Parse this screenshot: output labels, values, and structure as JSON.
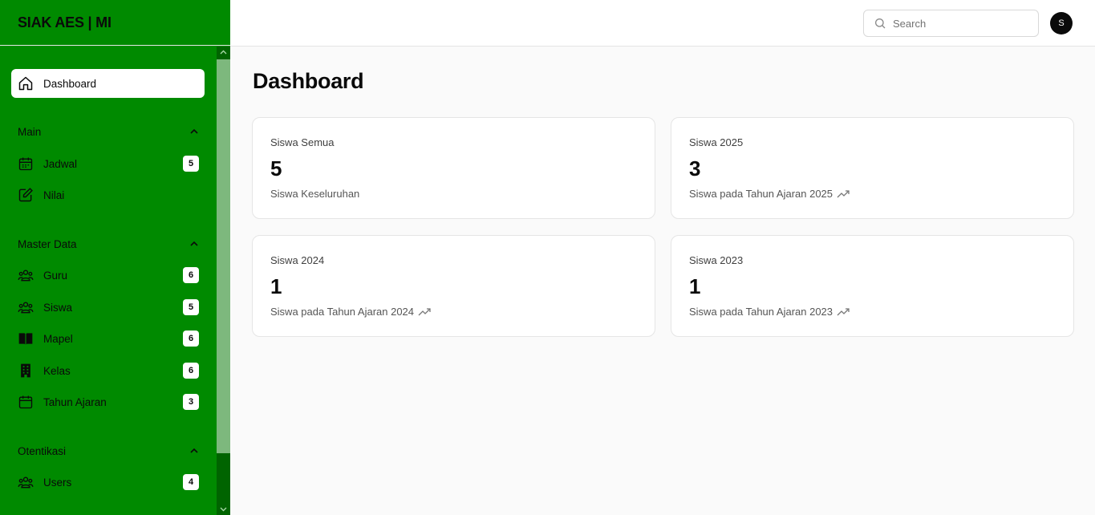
{
  "app": {
    "brand": "SIAK AES | MI"
  },
  "sidebar": {
    "active_item": {
      "label": "Dashboard",
      "icon": "home-icon"
    },
    "groups": [
      {
        "label": "Main",
        "items": [
          {
            "label": "Jadwal",
            "icon": "calendar-grid-icon",
            "badge": "5"
          },
          {
            "label": "Nilai",
            "icon": "edit-icon",
            "badge": ""
          }
        ]
      },
      {
        "label": "Master Data",
        "items": [
          {
            "label": "Guru",
            "icon": "users-icon",
            "badge": "6"
          },
          {
            "label": "Siswa",
            "icon": "users-icon",
            "badge": "5"
          },
          {
            "label": "Mapel",
            "icon": "book-icon",
            "badge": "6"
          },
          {
            "label": "Kelas",
            "icon": "building-icon",
            "badge": "6"
          },
          {
            "label": "Tahun Ajaran",
            "icon": "calendar-icon",
            "badge": "3"
          }
        ]
      },
      {
        "label": "Otentikasi",
        "items": [
          {
            "label": "Users",
            "icon": "users-icon",
            "badge": "4"
          }
        ]
      }
    ]
  },
  "header": {
    "search_placeholder": "Search",
    "avatar_initial": "S"
  },
  "main": {
    "title": "Dashboard",
    "cards": [
      {
        "title": "Siswa Semua",
        "value": "5",
        "subtitle": "Siswa Keseluruhan",
        "trend_icon": false
      },
      {
        "title": "Siswa 2025",
        "value": "3",
        "subtitle": "Siswa pada Tahun Ajaran 2025",
        "trend_icon": true
      },
      {
        "title": "Siswa 2024",
        "value": "1",
        "subtitle": "Siswa pada Tahun Ajaran 2024",
        "trend_icon": true
      },
      {
        "title": "Siswa 2023",
        "value": "1",
        "subtitle": "Siswa pada Tahun Ajaran 2023",
        "trend_icon": true
      }
    ]
  },
  "colors": {
    "sidebar_bg": "#008a00",
    "scroll_track": "#006400",
    "scroll_thumb": "#7db87d"
  }
}
